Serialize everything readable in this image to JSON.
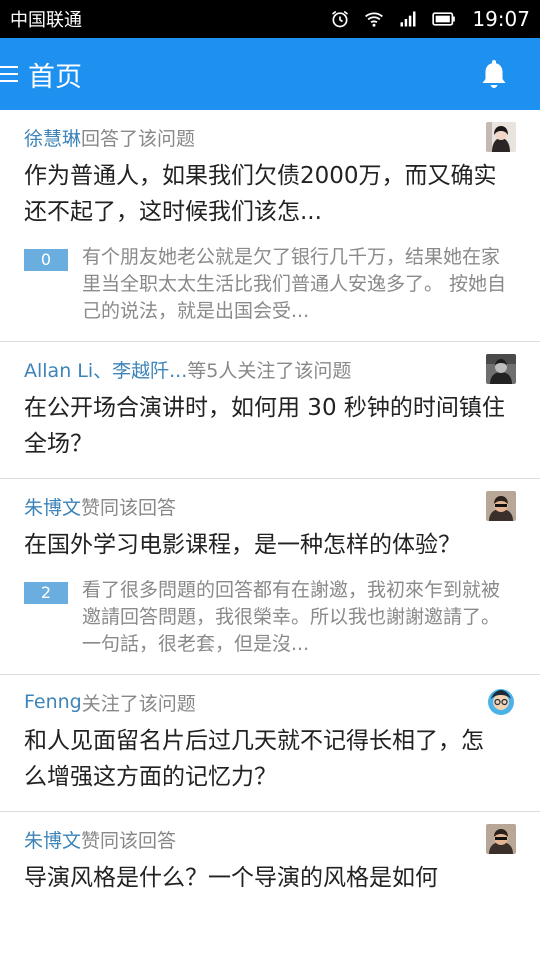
{
  "status": {
    "carrier": "中国联通",
    "time": "19:07"
  },
  "header": {
    "title": "首页"
  },
  "colors": {
    "appbar": "#1e90f0",
    "link": "#3d84b8",
    "vote_badge": "#6aaee0"
  },
  "feed": [
    {
      "actor": "徐慧琳",
      "action": " 回答了该问题",
      "question": "作为普通人，如果我们欠债2000万，而又确实还不起了，这时候我们该怎...",
      "votes": "0",
      "answer": "有个朋友她老公就是欠了银行几千万，结果她在家里当全职太太生活比我们普通人安逸多了。 按她自己的说法，就是出国会受..."
    },
    {
      "actor": "Allan Li、李越阡...",
      "action": "等5人关注了该问题",
      "question": "在公开场合演讲时，如何用 30 秒钟的时间镇住全场？"
    },
    {
      "actor": "朱博文",
      "action": " 赞同该回答",
      "question": "在国外学习电影课程，是一种怎样的体验？",
      "votes": "2",
      "answer": "看了很多問題的回答都有在謝邀，我初來乍到就被邀請回答問題，我很榮幸。所以我也謝謝邀請了。 一句話，很老套，但是沒..."
    },
    {
      "actor": "Fenng",
      "action": " 关注了该问题",
      "question": "和人见面留名片后过几天就不记得长相了，怎么增强这方面的记忆力？"
    },
    {
      "actor": "朱博文",
      "action": " 赞同该回答",
      "question": "导演风格是什么？一个导演的风格是如何"
    }
  ]
}
